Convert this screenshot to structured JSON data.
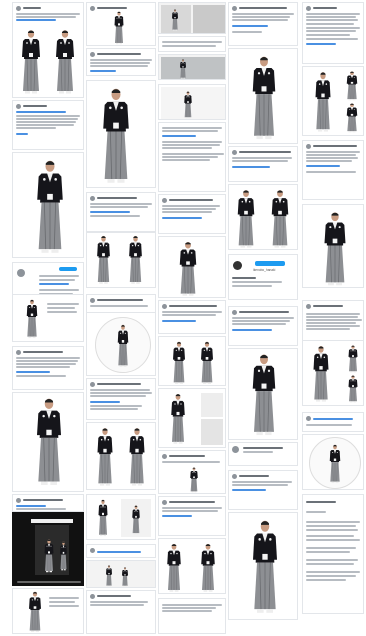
{
  "profile": {
    "name": "ikenobo_hanaki",
    "handle": "ikenobo_hanaki"
  },
  "thumbnails": {
    "figure_icon": "kimono-hakama-figure",
    "count_cards": 48
  }
}
